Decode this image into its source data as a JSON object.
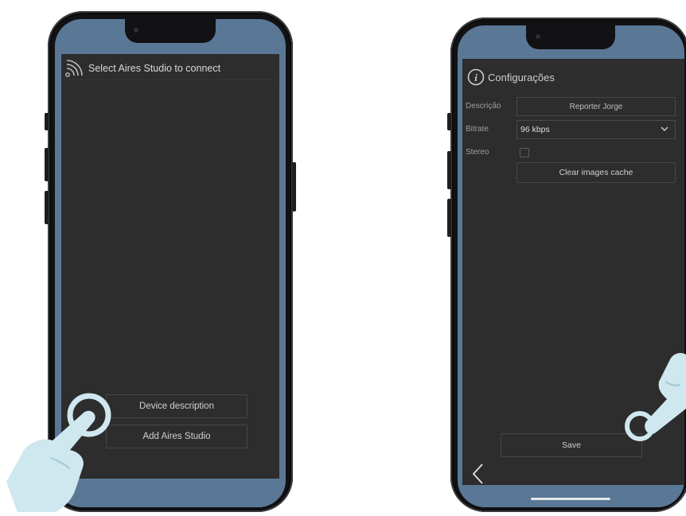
{
  "left_phone": {
    "header_text": "Select Aires Studio to connect",
    "wifi_icon": "wifi-signal-icon",
    "buttons": {
      "device_description": "Device description",
      "add_aires_studio": "Add Aires Studio"
    }
  },
  "right_phone": {
    "title": "Configurações",
    "info_icon": "info-icon",
    "fields": {
      "descricao_label": "Descrição",
      "descricao_value": "Reporter Jorge",
      "bitrate_label": "Bitrate",
      "bitrate_value": "96 kbps",
      "stereo_label": "Stereo"
    },
    "clear_cache_button": "Clear images cache",
    "save_button": "Save",
    "back_icon": "chevron-left-icon"
  },
  "colors": {
    "screen_bg": "#2d2d2d",
    "bezel_blue": "#5a7896",
    "hand_color": "#cfe7ee",
    "phone_body": "#121214"
  }
}
